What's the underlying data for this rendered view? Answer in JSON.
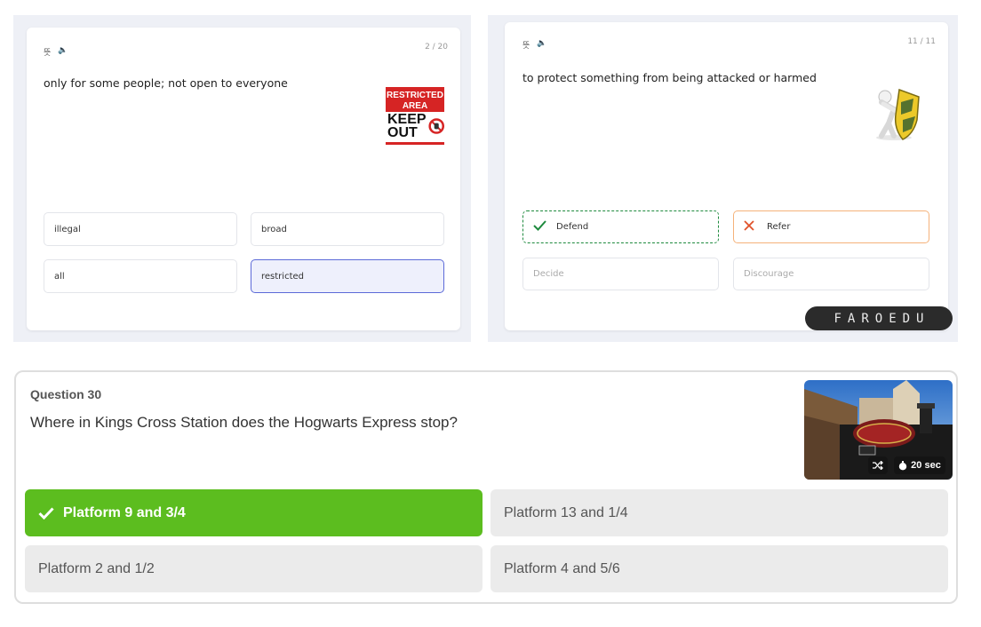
{
  "card_left": {
    "icons": [
      "definition-icon",
      "speaker-icon"
    ],
    "icon_glyphs": [
      "뜻",
      "🔈"
    ],
    "counter": "2 / 20",
    "prompt": "only for some people; not open to everyone",
    "image_lines": [
      "RESTRICTED",
      "AREA",
      "KEEP",
      "OUT"
    ],
    "options": [
      "illegal",
      "broad",
      "all",
      "restricted"
    ],
    "selected": "restricted"
  },
  "card_right": {
    "icons": [
      "definition-icon",
      "speaker-icon"
    ],
    "icon_glyphs": [
      "뜻",
      "🔈"
    ],
    "counter": "11 / 11",
    "prompt": "to protect something from being attacked or harmed",
    "options": [
      "Defend",
      "Refer",
      "Decide",
      "Discourage"
    ],
    "correct": "Defend",
    "wrong": "Refer"
  },
  "watermark": "FAROEDU",
  "quiz": {
    "question_number": "Question 30",
    "question": "Where in Kings Cross Station does the Hogwarts Express stop?",
    "timer": "20 sec",
    "answers": [
      "Platform 9 and 3/4",
      "Platform 13 and 1/4",
      "Platform 2 and 1/2",
      "Platform 4 and 5/6"
    ],
    "correct_answer": "Platform 9 and 3/4"
  },
  "colors": {
    "correct_green": "#5cbd1f",
    "selected_blue": "#5c6ad8",
    "wrong_orange": "#f5b27a",
    "defend_green": "#1e8a3e",
    "refer_x": "#e0522a"
  }
}
